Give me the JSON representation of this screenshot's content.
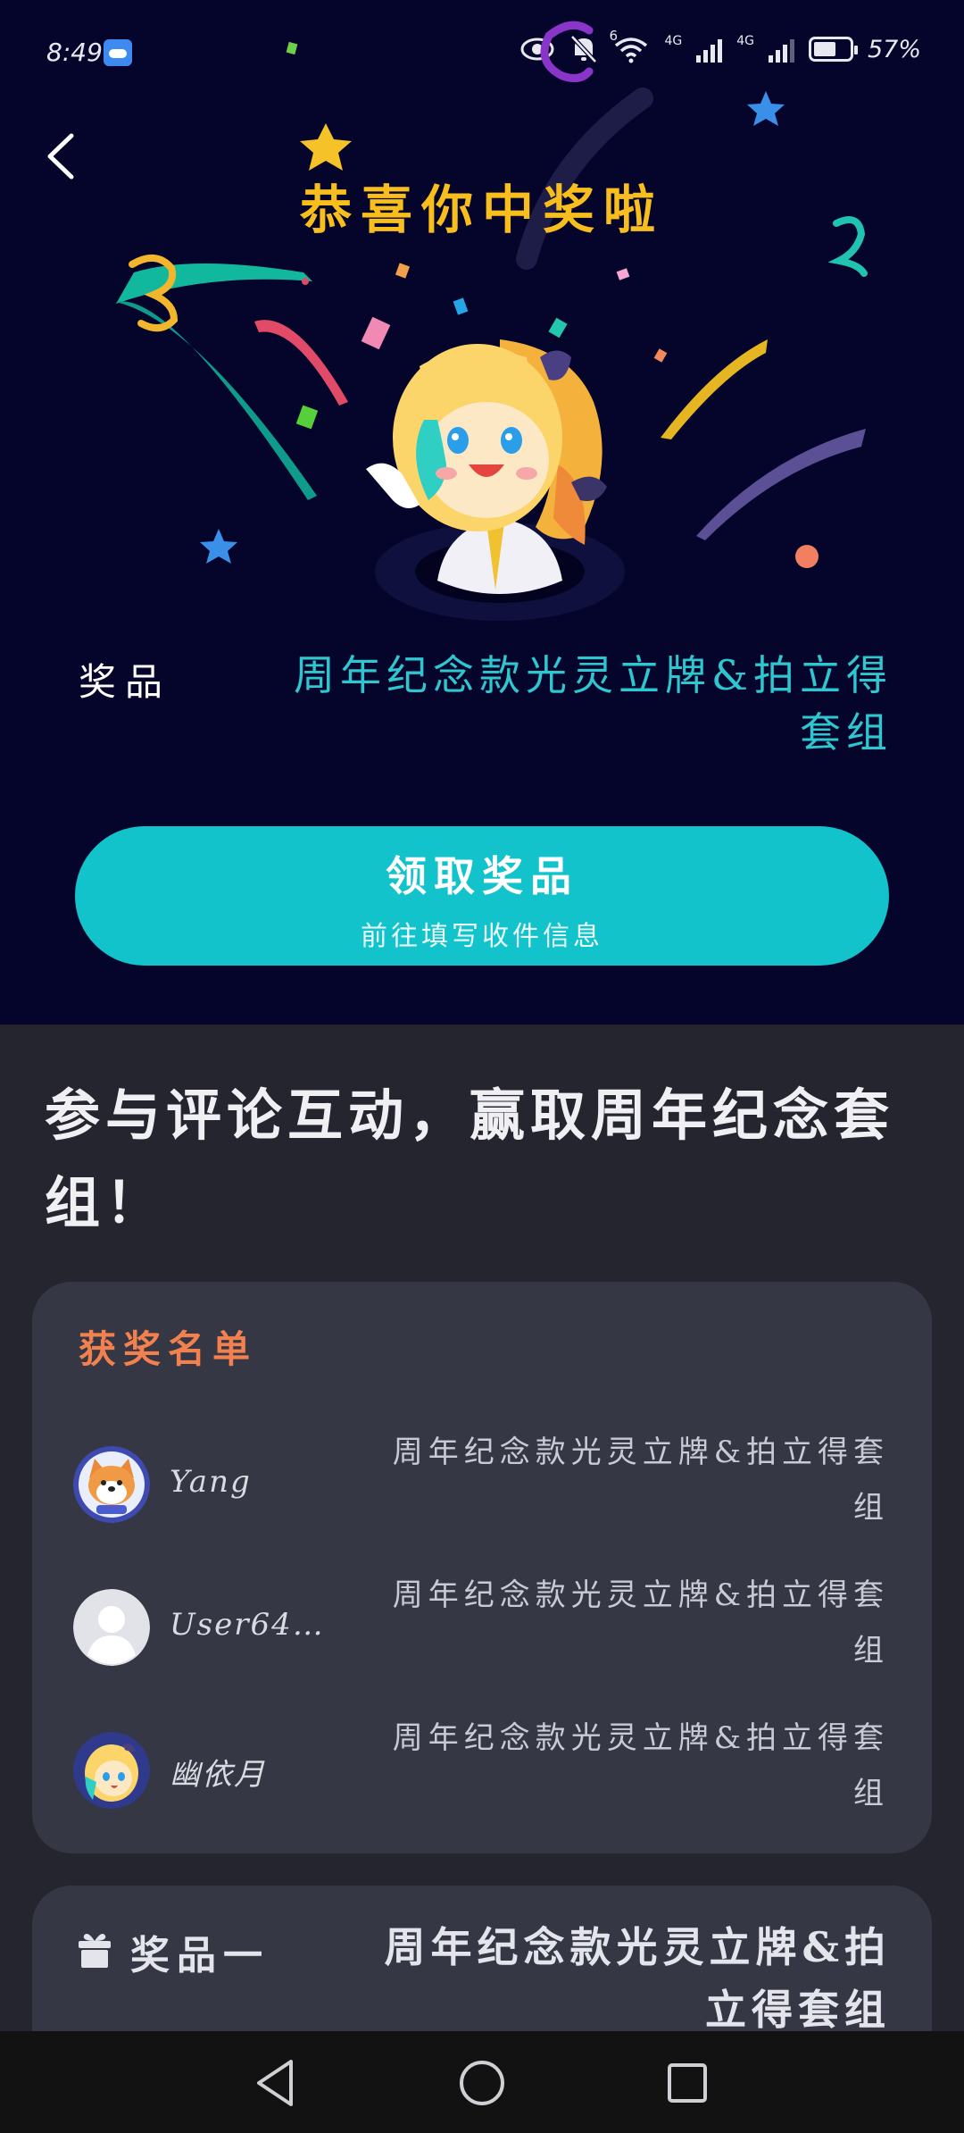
{
  "status_bar": {
    "time": "8:49",
    "battery_text": "57%",
    "network_1": "4G",
    "network_2": "4G",
    "wifi_badge": "6"
  },
  "hero": {
    "title": "恭喜你中奖啦",
    "prize_label": "奖品",
    "prize_name": "周年纪念款光灵立牌&拍立得套组",
    "claim_button": {
      "title": "领取奖品",
      "subtitle": "前往填写收件信息"
    }
  },
  "section": {
    "heading": "参与评论互动，赢取周年纪念套组！"
  },
  "winners": {
    "title": "获奖名单",
    "rows": [
      {
        "name": "Yang",
        "prize": "周年纪念款光灵立牌&拍立得套组",
        "avatar": "shiba-avatar"
      },
      {
        "name": "User64…",
        "prize": "周年纪念款光灵立牌&拍立得套组",
        "avatar": "default-avatar"
      },
      {
        "name": "幽依月",
        "prize": "周年纪念款光灵立牌&拍立得套组",
        "avatar": "anime-avatar"
      }
    ]
  },
  "prize_card": {
    "label": "奖品一",
    "value": "周年纪念款光灵立牌&拍立得套组"
  },
  "colors": {
    "hero_bg": "#05052c",
    "title_gold": "#f7be1e",
    "accent_teal": "#13c3cb",
    "prize_teal": "#2ec6cf",
    "winners_orange": "#f3814f",
    "card_bg": "#353844",
    "page_bg": "#24252f"
  },
  "nav": {
    "back": "back-triangle-icon",
    "home": "home-circle-icon",
    "recents": "recents-square-icon"
  }
}
